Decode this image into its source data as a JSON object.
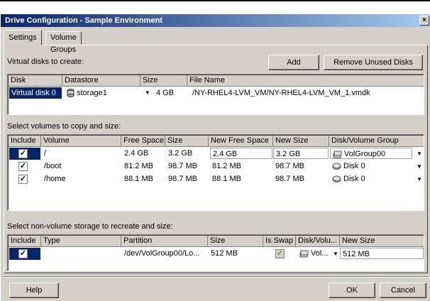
{
  "window": {
    "title": "Drive Configuration - Sample Environment",
    "close_glyph": "×"
  },
  "tabs": [
    {
      "label": "Settings"
    },
    {
      "label": "Volume Groups"
    }
  ],
  "virtual_disks": {
    "section_label": "Virtual disks to create:",
    "add_label": "Add",
    "remove_label": "Remove Unused Disks",
    "columns": [
      "Disk",
      "Datastore",
      "Size",
      "File Name"
    ],
    "rows": [
      {
        "disk": "Virtual disk 0",
        "datastore": "storage1",
        "size": "4 GB",
        "file": "/NY-RHEL4-LVM_VM/NY-RHEL4-LVM_VM_1.vmdk"
      }
    ]
  },
  "volumes": {
    "section_label": "Select volumes to copy and size:",
    "columns": [
      "Include",
      "Volume",
      "Free Space",
      "Size",
      "New Free Space",
      "New Size",
      "Disk/Volume Group"
    ],
    "rows": [
      {
        "include": true,
        "volume": "/",
        "free": "2.4 GB",
        "size": "3.2 GB",
        "new_free": "2.4 GB",
        "new_size": "3.2 GB",
        "group": "VolGroup00"
      },
      {
        "include": true,
        "volume": "/boot",
        "free": "81.2 MB",
        "size": "98.7 MB",
        "new_free": "81.2 MB",
        "new_size": "98.7 MB",
        "group": "Disk 0"
      },
      {
        "include": true,
        "volume": "/home",
        "free": "88.1 MB",
        "size": "98.7 MB",
        "new_free": "88.1 MB",
        "new_size": "98.7 MB",
        "group": "Disk 0"
      }
    ]
  },
  "nonvolume": {
    "section_label": "Select non-volume storage to recreate and size:",
    "columns": [
      "Include",
      "Type",
      "Partition",
      "Size",
      "Is Swap",
      "Disk/Volu...",
      "New Size"
    ],
    "rows": [
      {
        "include": true,
        "type": "",
        "partition": "/dev/VolGroup00/Lo...",
        "size": "512 MB",
        "is_swap": true,
        "group": "Vol...",
        "new_size": "512 MB"
      }
    ]
  },
  "footer": {
    "help_label": "Help",
    "ok_label": "OK",
    "cancel_label": "Cancel"
  },
  "check_glyph": "✓",
  "dropdown_glyph": "▼",
  "colors": {
    "title_start": "#0a246a",
    "title_end": "#a6caf0",
    "selection": "#0a246a",
    "face": "#d4d0c8"
  }
}
